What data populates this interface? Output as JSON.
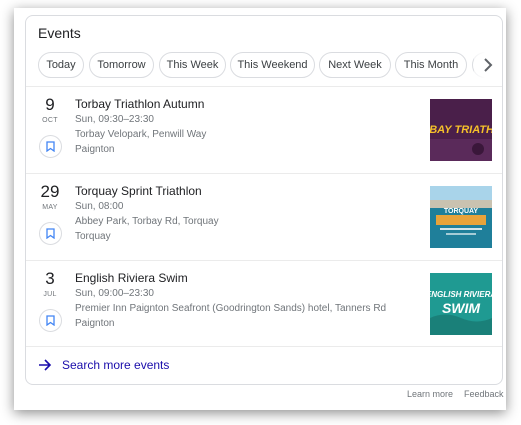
{
  "card": {
    "title": "Events"
  },
  "chips": [
    {
      "label": "Today"
    },
    {
      "label": "Tomorrow"
    },
    {
      "label": "This Week"
    },
    {
      "label": "This Weekend"
    },
    {
      "label": "Next Week"
    },
    {
      "label": "This Month"
    }
  ],
  "events": [
    {
      "day": "9",
      "month": "OCT",
      "name": "Torbay Triathlon Autumn",
      "time": "Sun, 09:30–23:30",
      "venue": "Torbay Velopark, Penwill Way",
      "town": "Paignton",
      "thumb_text": "RBAY TRIATHL",
      "thumb_color": "#4a1f4a"
    },
    {
      "day": "29",
      "month": "MAY",
      "name": "Torquay Sprint Triathlon",
      "time": "Sun, 08:00",
      "venue": "Abbey Park, Torbay Rd, Torquay",
      "town": "Torquay",
      "thumb_text": "TORQUAY",
      "thumb_color": "#1f7f9a"
    },
    {
      "day": "3",
      "month": "JUL",
      "name": "English Riviera Swim",
      "time": "Sun, 09:00–23:30",
      "venue": "Premier Inn Paignton Seafront (Goodrington Sands) hotel, Tanners Rd",
      "town": "Paignton",
      "thumb_text_1": "ENGLISH RIVIERA",
      "thumb_text_2": "SWIM",
      "thumb_color": "#1f9a92"
    }
  ],
  "search_more": {
    "label": "Search more events"
  },
  "footer": {
    "learn_more": "Learn more",
    "feedback": "Feedback"
  },
  "colors": {
    "link": "#1a0dab",
    "bookmark": "#4285f4",
    "border": "#dadce0"
  }
}
